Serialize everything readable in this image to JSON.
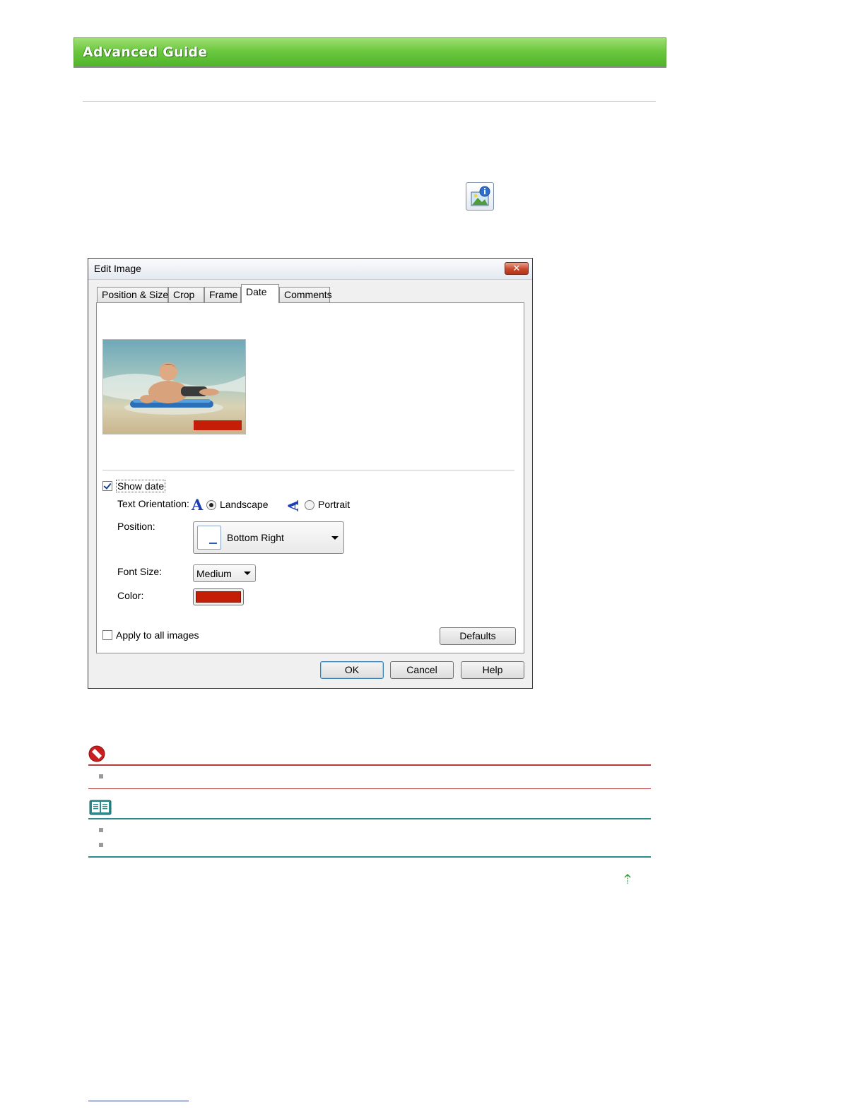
{
  "header": {
    "title": "Advanced Guide"
  },
  "dialog": {
    "title": "Edit Image",
    "close_label": "✕",
    "tabs": [
      {
        "label": "Position & Size"
      },
      {
        "label": "Crop"
      },
      {
        "label": "Frame"
      },
      {
        "label": "Date",
        "active": true
      },
      {
        "label": "Comments"
      }
    ],
    "show_date": {
      "label": "Show date",
      "checked": true
    },
    "text_orientation": {
      "label": "Text Orientation:",
      "landscape_label": "Landscape",
      "portrait_label": "Portrait",
      "selected": "Landscape"
    },
    "position": {
      "label": "Position:",
      "value": "Bottom Right"
    },
    "font_size": {
      "label": "Font Size:",
      "value": "Medium"
    },
    "color": {
      "label": "Color:",
      "value": "#c41e08"
    },
    "apply_all": {
      "label": "Apply to all images",
      "checked": false
    },
    "defaults_label": "Defaults",
    "ok_label": "OK",
    "cancel_label": "Cancel",
    "help_label": "Help"
  },
  "colors": {
    "banner_green": "#6cc83f",
    "important_red": "#b83b3b",
    "note_teal": "#2e8b8b",
    "date_color": "#c41e08"
  }
}
